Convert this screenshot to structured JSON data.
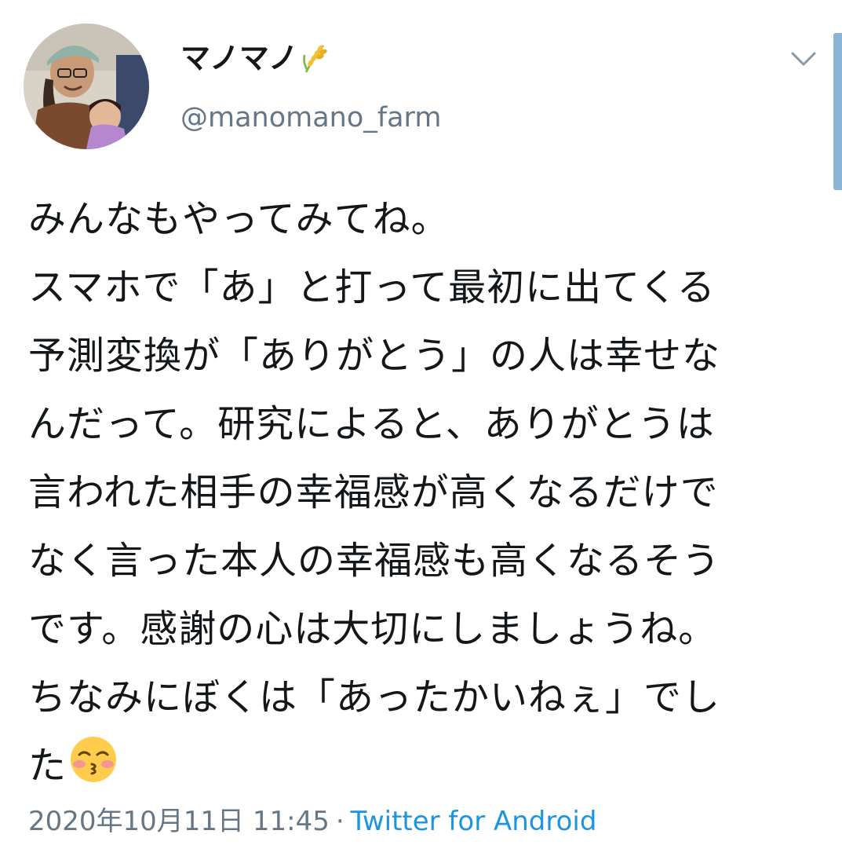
{
  "author": {
    "display_name": "マノマノ",
    "name_icon": "rice-plant-icon",
    "handle": "@manomano_farm"
  },
  "menu_icon": "chevron-down-icon",
  "tweet": {
    "lines": [
      "みんなもやってみてね。",
      "スマホで「あ」と打って最初に出てくる",
      "予測変換が「ありがとう」の人は幸せな",
      "んだって。研究によると、ありがとうは",
      "言われた相手の幸福感が高くなるだけで",
      "なく言った本人の幸福感も高くなるそう",
      "です。感謝の心は大切にしましょうね。",
      "ちなみにぼくは「あったかいねぇ」でし",
      "た"
    ],
    "trailing_emoji": "kissing-face-with-closed-eyes-icon"
  },
  "meta": {
    "timestamp": "2020年10月11日 11:45",
    "separator": "·",
    "source": "Twitter for Android"
  },
  "colors": {
    "text": "#14171a",
    "secondary": "#657786",
    "link": "#1b95e0"
  }
}
